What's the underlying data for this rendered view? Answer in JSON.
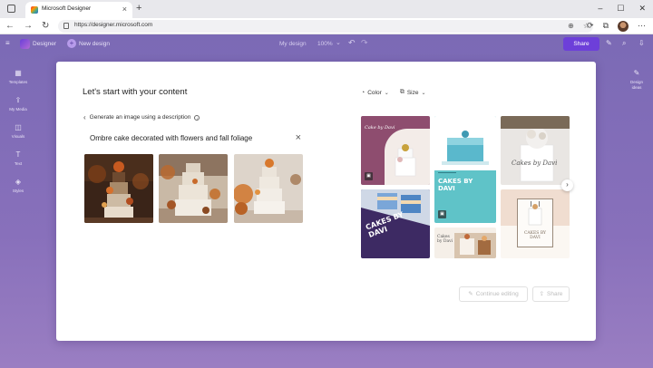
{
  "browser": {
    "tab_title": "Microsoft Designer",
    "tab_close": "×",
    "new_tab": "+",
    "window_controls": [
      "–",
      "☐",
      "✕"
    ],
    "url": "https://designer.microsoft.com",
    "nav": {
      "back": "←",
      "forward": "→",
      "refresh": "↻"
    }
  },
  "app": {
    "brand": "Designer",
    "new_design_label": "New design",
    "document_name": "My design",
    "zoom_level": "100%",
    "share_label": "Share",
    "left_rail": [
      {
        "icon": "templates-icon",
        "glyph": "▦",
        "label": "Templates"
      },
      {
        "icon": "my-media-icon",
        "glyph": "⇪",
        "label": "My Media"
      },
      {
        "icon": "visuals-icon",
        "glyph": "◫",
        "label": "Visuals"
      },
      {
        "icon": "text-icon",
        "glyph": "T",
        "label": "Text"
      },
      {
        "icon": "styles-icon",
        "glyph": "◈",
        "label": "Styles"
      }
    ],
    "right_rail": {
      "icon": "design-ideas-icon",
      "glyph": "✎",
      "label_line1": "Design",
      "label_line2": "ideas"
    }
  },
  "modal": {
    "title": "Let's start with your content",
    "back_label": "Generate an image using a description",
    "prompt_value": "Ombre cake decorated with flowers and fall foliage",
    "clear_icon": "close-icon",
    "generated_images": [
      {
        "name": "generated-image-1",
        "description": "cake-dark-autumn"
      },
      {
        "name": "generated-image-2",
        "description": "cake-white-leaves"
      },
      {
        "name": "generated-image-3",
        "description": "cake-white-orange-foliage"
      }
    ],
    "filters": [
      {
        "label": "Color",
        "icon": "palette-icon"
      },
      {
        "label": "Size",
        "icon": "resize-icon"
      }
    ],
    "templates": [
      {
        "name": "template-cake-by-davi-script",
        "text": "Cake by Davi"
      },
      {
        "name": "template-cakes-by-davi-teal",
        "text": "CAKES BY DAVI"
      },
      {
        "name": "template-cakes-by-davi-white",
        "text": "Cakes by Davi"
      },
      {
        "name": "template-cakes-by-davi-purple",
        "text": "CAKES BY DAVI"
      },
      {
        "name": "template-cakes-by-davi-small",
        "text": "Cakes by Davi"
      },
      {
        "name": "template-cakes-by-davi-frame",
        "text": "CAKES BY DAVI"
      }
    ],
    "continue_label": "Continue editing",
    "share_label": "Share"
  },
  "colors": {
    "accent": "#6d3fd9",
    "app_background": "#8a74bd",
    "teal_template": "#5fc3c8",
    "purple_template": "#3d2a63",
    "mauve_template": "#8e4d6f"
  }
}
